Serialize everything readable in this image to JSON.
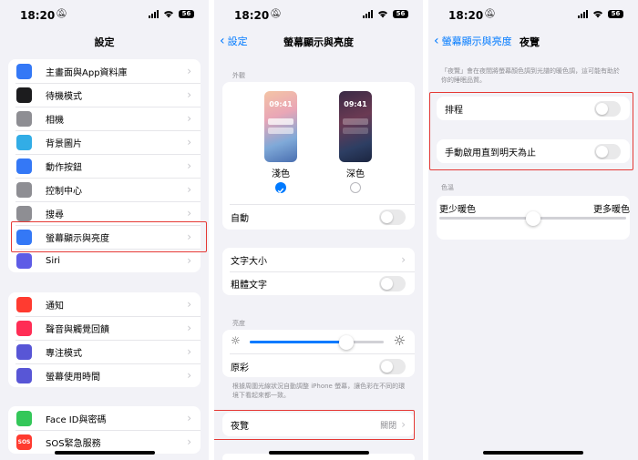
{
  "status": {
    "time": "18:20",
    "battery": "56"
  },
  "p1": {
    "title": "設定",
    "group1": [
      {
        "label": "主畫面與App資料庫",
        "icon": "home-grid-icon",
        "color": "#3478f6"
      },
      {
        "label": "待機模式",
        "icon": "standby-icon",
        "color": "#1c1c1e"
      },
      {
        "label": "相機",
        "icon": "camera-icon",
        "color": "#8e8e93"
      },
      {
        "label": "背景圖片",
        "icon": "wallpaper-icon",
        "color": "#32ade6"
      },
      {
        "label": "動作按鈕",
        "icon": "action-button-icon",
        "color": "#3478f6"
      },
      {
        "label": "控制中心",
        "icon": "control-center-icon",
        "color": "#8e8e93"
      },
      {
        "label": "搜尋",
        "icon": "search-icon",
        "color": "#8e8e93"
      },
      {
        "label": "螢幕顯示與亮度",
        "icon": "brightness-icon",
        "color": "#3478f6"
      },
      {
        "label": "Siri",
        "icon": "siri-icon",
        "color": "#5e5ce6"
      }
    ],
    "group2": [
      {
        "label": "通知",
        "icon": "bell-icon",
        "color": "#ff3b30"
      },
      {
        "label": "聲音與觸覺回饋",
        "icon": "speaker-icon",
        "color": "#ff2d55"
      },
      {
        "label": "專注模式",
        "icon": "moon-icon",
        "color": "#5856d6"
      },
      {
        "label": "螢幕使用時間",
        "icon": "hourglass-icon",
        "color": "#5856d6"
      }
    ],
    "group3": [
      {
        "label": "Face ID與密碼",
        "icon": "face-id-icon",
        "color": "#34c759"
      },
      {
        "label": "SOS緊急服務",
        "icon": "sos-icon",
        "color": "#ff3b30",
        "text": "SOS"
      }
    ]
  },
  "p2": {
    "back": "設定",
    "title": "螢幕顯示與亮度",
    "appearance_header": "外觀",
    "light_label": "淺色",
    "dark_label": "深色",
    "preview_time": "09:41",
    "auto_label": "自動",
    "text_size_label": "文字大小",
    "bold_text_label": "粗體文字",
    "brightness_header": "亮度",
    "brightness_level": 0.72,
    "true_tone_label": "原彩",
    "true_tone_note": "根據周圍光線狀況自動調整 iPhone 螢幕，讓色彩在不同的環境下看起來都一致。",
    "night_shift_label": "夜覽",
    "night_shift_value": "關閉"
  },
  "p3": {
    "back": "螢幕顯示與亮度",
    "title": "夜覽",
    "description": "「夜覽」會在夜間將螢幕顏色調到光譜的暖色調，這可能有助於你的睡眠品質。",
    "schedule_label": "排程",
    "manual_label": "手動啟用直到明天為止",
    "temperature_header": "色溫",
    "less_warm": "更少暖色",
    "more_warm": "更多暖色",
    "temperature_level": 0.5
  }
}
